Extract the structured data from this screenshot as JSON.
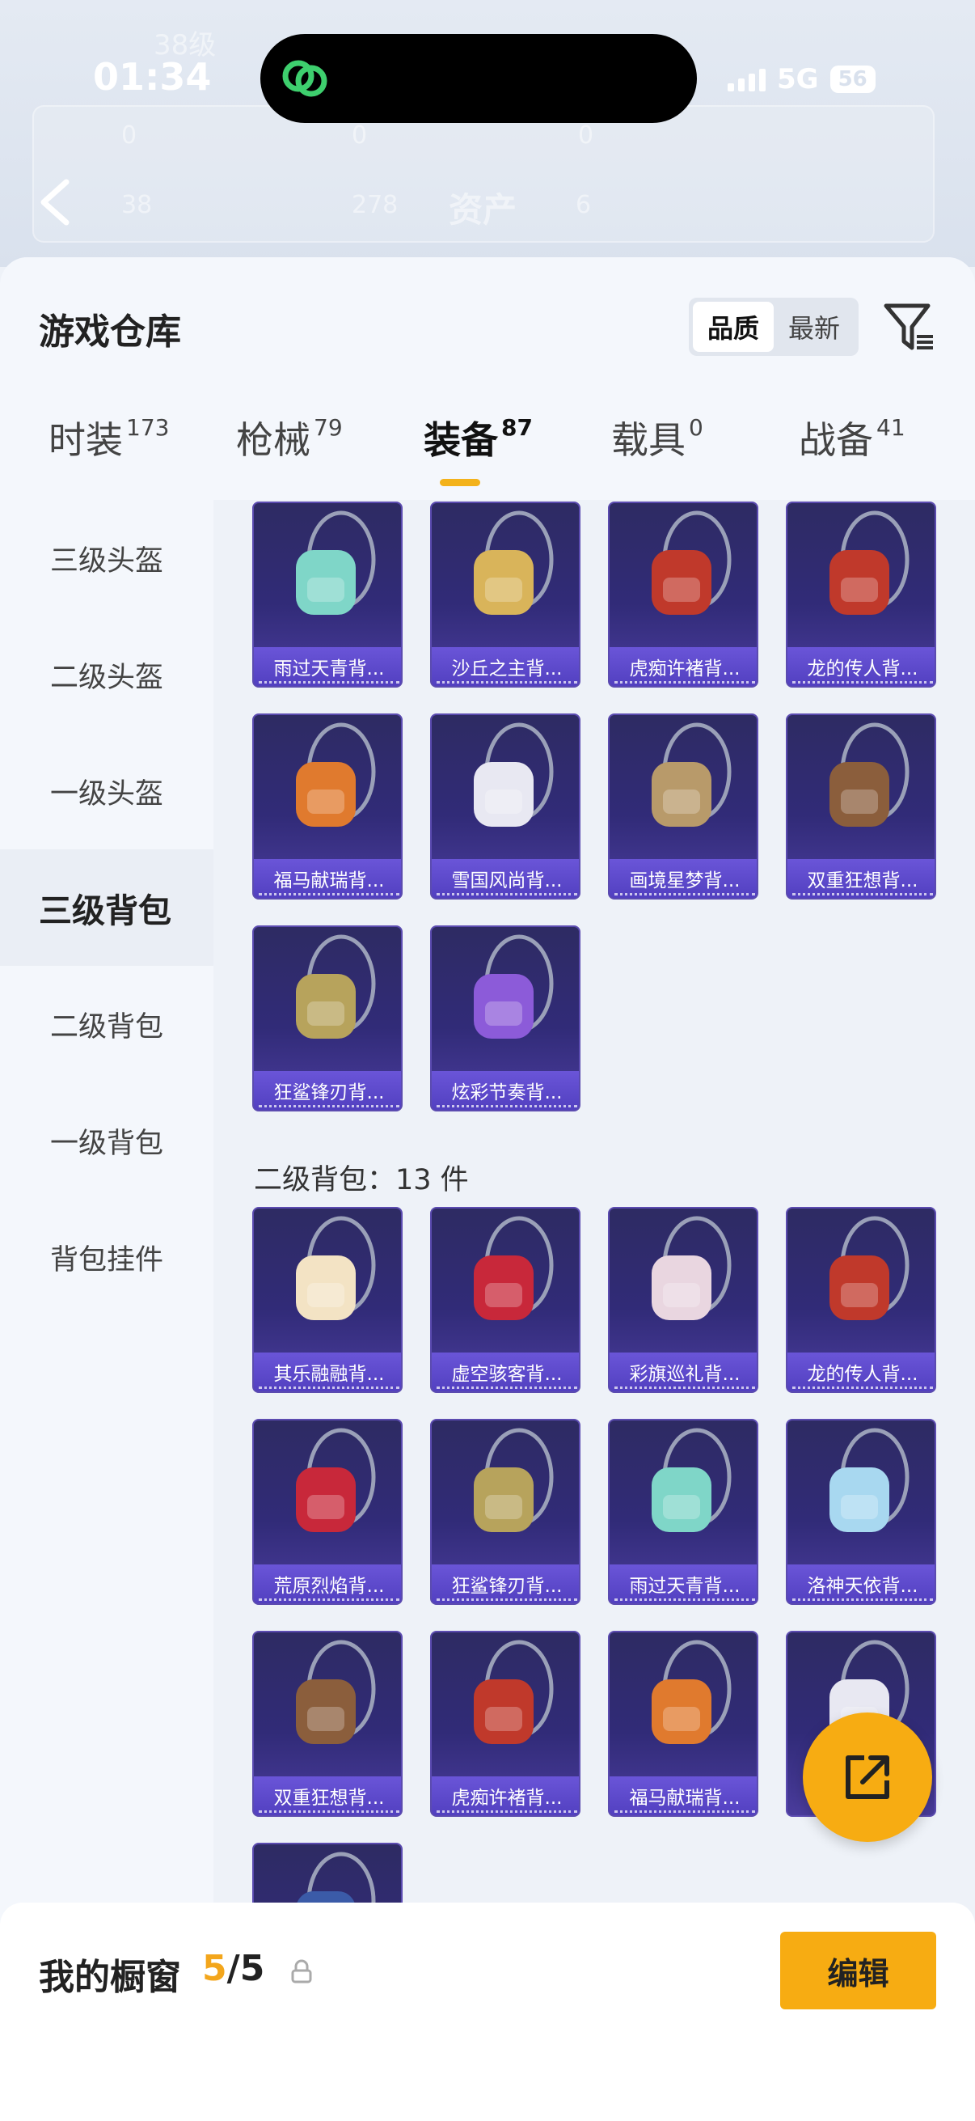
{
  "status": {
    "time": "01:34",
    "network": "5G",
    "battery": "56"
  },
  "background": {
    "level": "38级",
    "num_a": "0",
    "num_b": "0",
    "num_c": "0",
    "num_d": "38",
    "num_e": "278",
    "section": "资产",
    "num_f": "6"
  },
  "header": {
    "title": "游戏仓库",
    "sort": [
      "品质",
      "最新"
    ]
  },
  "tabs": [
    {
      "label": "时装",
      "count": "173"
    },
    {
      "label": "枪械",
      "count": "79"
    },
    {
      "label": "装备",
      "count": "87"
    },
    {
      "label": "载具",
      "count": "0"
    },
    {
      "label": "战备",
      "count": "41"
    }
  ],
  "sidebar": [
    "三级头盔",
    "二级头盔",
    "一级头盔",
    "三级背包",
    "二级背包",
    "一级背包",
    "背包挂件"
  ],
  "grid": {
    "level3": [
      "雨过天青背...",
      "沙丘之主背...",
      "虎痴许褚背...",
      "龙的传人背...",
      "福马献瑞背...",
      "雪国风尚背...",
      "画境星梦背...",
      "双重狂想背...",
      "狂鲨锋刃背...",
      "炫彩节奏背..."
    ],
    "level2_title": "二级背包：13 件",
    "level2": [
      "其乐融融背...",
      "虚空骇客背...",
      "彩旗巡礼背...",
      "龙的传人背...",
      "荒原烈焰背...",
      "狂鲨锋刃背...",
      "雨过天青背...",
      "洛神天依背...",
      "双重狂想背...",
      "虎痴许褚背...",
      "福马献瑞背...",
      "",
      ""
    ]
  },
  "bottom": {
    "title": "我的橱窗",
    "count_current": "5",
    "count_total": "/5",
    "edit_label": "编辑"
  },
  "colors": {
    "accent": "#f7ac12",
    "card": "#312b78",
    "card_label": "#5b47c8"
  }
}
